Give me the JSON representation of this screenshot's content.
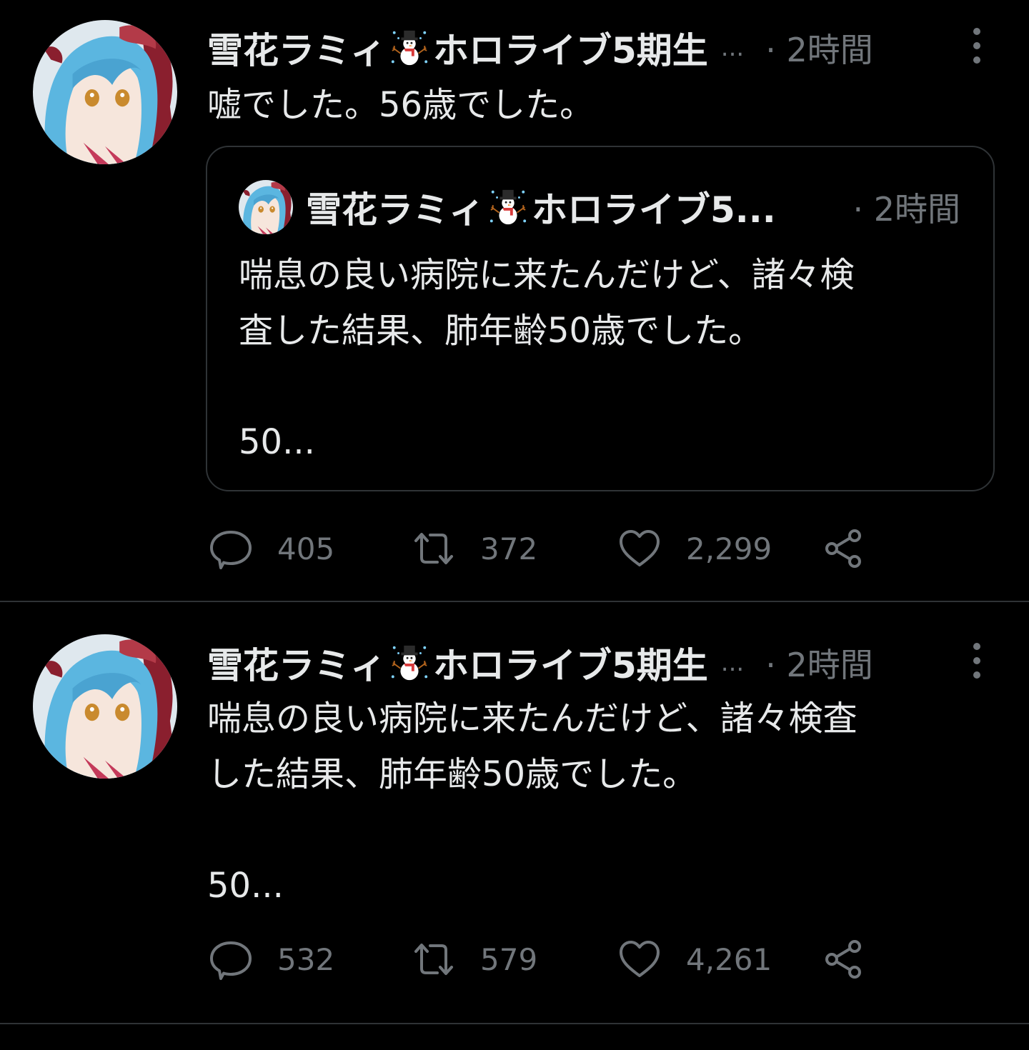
{
  "tweets": [
    {
      "display_name": "雪花ラミィ",
      "name_suffix": "ホロライブ5期生",
      "name_ellipsis": "...",
      "time": "· 2時間",
      "text": "嘘でした。56歳でした。",
      "quoted": {
        "display_name": "雪花ラミィ",
        "name_suffix": "ホロライブ5...",
        "time": "· 2時間",
        "text": "喘息の良い病院に来たんだけど、諸々検\n査した結果、肺年齢50歳でした。\n\n50..."
      },
      "stats": {
        "replies": "405",
        "retweets": "372",
        "likes": "2,299"
      }
    },
    {
      "display_name": "雪花ラミィ",
      "name_suffix": "ホロライブ5期生",
      "name_ellipsis": "...",
      "time": "· 2時間",
      "text": "喘息の良い病院に来たんだけど、諸々検査\nした結果、肺年齢50歳でした。\n\n50...",
      "stats": {
        "replies": "532",
        "retweets": "579",
        "likes": "4,261"
      }
    }
  ],
  "icons": {
    "avatar": "avatar-image",
    "name_emoji": "snowman-icon",
    "more": "more-vertical-icon",
    "reply": "reply-icon",
    "retweet": "retweet-icon",
    "like": "heart-icon",
    "share": "share-icon"
  },
  "colors": {
    "background": "#000000",
    "primary_text": "#e7e9ea",
    "secondary_text": "#71767b",
    "border": "#2f3336",
    "avatar_hair": "#5bb6e0"
  }
}
